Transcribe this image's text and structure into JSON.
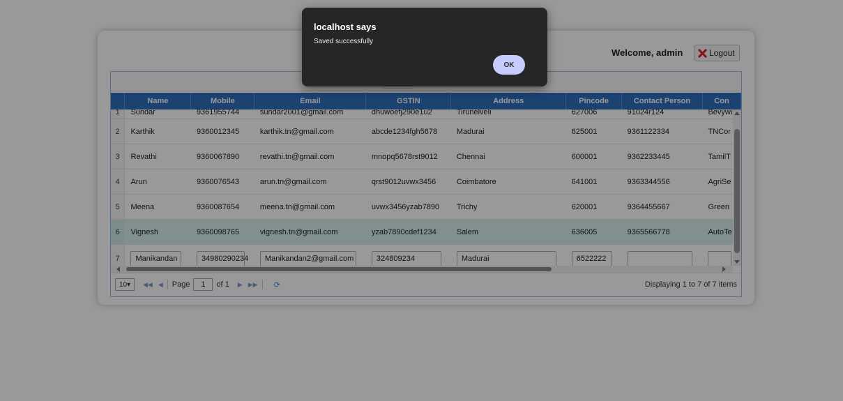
{
  "header": {
    "welcome": "Welcome, admin",
    "logout_label": "Logout"
  },
  "grid": {
    "columns": [
      "Name",
      "Mobile",
      "Email",
      "GSTIN",
      "Address",
      "Pincode",
      "Contact Person",
      "Con"
    ],
    "rows": [
      {
        "num": "1",
        "name": "Sundar",
        "mobile": "9361955744",
        "email": "sundar2001@gmail.com",
        "gstin": "dhuwoefj290e1u2",
        "address": "Tirunelveli",
        "pincode": "627006",
        "contact_person": "91024r124",
        "con": "Bevywi"
      },
      {
        "num": "2",
        "name": "Karthik",
        "mobile": "9360012345",
        "email": "karthik.tn@gmail.com",
        "gstin": "abcde1234fgh5678",
        "address": "Madurai",
        "pincode": "625001",
        "contact_person": "9361122334",
        "con": "TNCor"
      },
      {
        "num": "3",
        "name": "Revathi",
        "mobile": "9360067890",
        "email": "revathi.tn@gmail.com",
        "gstin": "mnopq5678rst9012",
        "address": "Chennai",
        "pincode": "600001",
        "contact_person": "9362233445",
        "con": "TamilT"
      },
      {
        "num": "4",
        "name": "Arun",
        "mobile": "9360076543",
        "email": "arun.tn@gmail.com",
        "gstin": "qrst9012uvwx3456",
        "address": "Coimbatore",
        "pincode": "641001",
        "contact_person": "9363344556",
        "con": "AgriSe"
      },
      {
        "num": "5",
        "name": "Meena",
        "mobile": "9360087654",
        "email": "meena.tn@gmail.com",
        "gstin": "uvwx3456yzab7890",
        "address": "Trichy",
        "pincode": "620001",
        "contact_person": "9364455667",
        "con": "Green"
      },
      {
        "num": "6",
        "name": "Vignesh",
        "mobile": "9360098765",
        "email": "vignesh.tn@gmail.com",
        "gstin": "yzab7890cdef1234",
        "address": "Salem",
        "pincode": "636005",
        "contact_person": "9365566778",
        "con": "AutoTe"
      }
    ],
    "edit_row": {
      "num": "7",
      "name": "Manikandan",
      "mobile": "34980290234",
      "email": "Manikandan2@gmail.com",
      "gstin": "324809234",
      "address": "Madurai",
      "pincode": "6522222",
      "contact_person": "",
      "con": ""
    }
  },
  "pager": {
    "page_size": "10",
    "page_label": "Page",
    "page_value": "1",
    "of_label": "of 1",
    "display_text": "Displaying 1 to 7 of 7 items"
  },
  "dialog": {
    "title": "localhost says",
    "message": "Saved successfully",
    "ok_label": "OK"
  },
  "colors": {
    "header_blue": "#2f6fbe",
    "selected_row": "#d8f1ef",
    "dialog_bg": "#262626",
    "ok_button": "#c6cdfd"
  }
}
